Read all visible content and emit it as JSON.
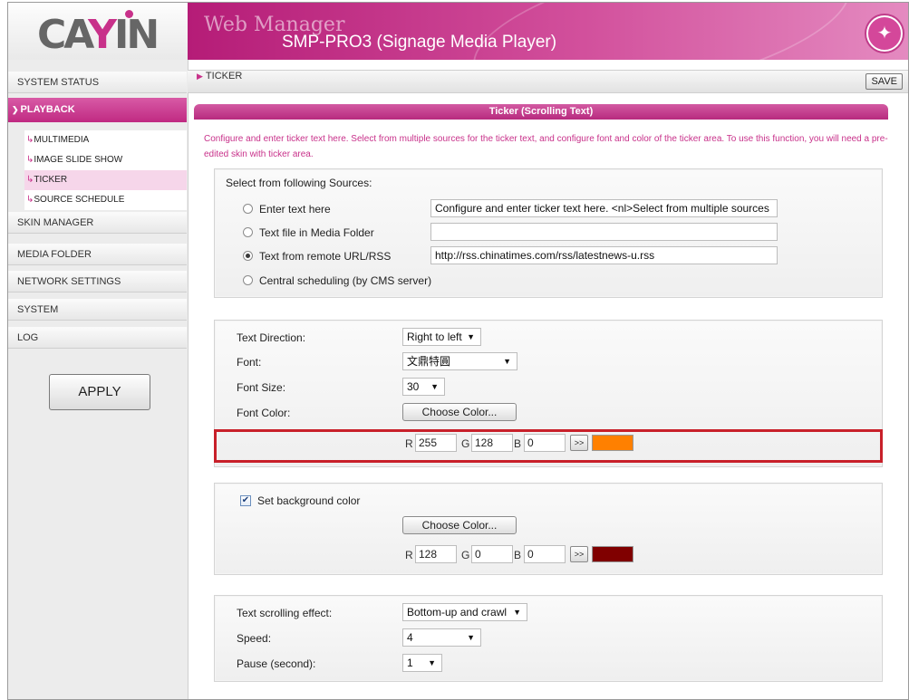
{
  "header": {
    "logo_text": "CAYIN",
    "web_manager": "Web Manager",
    "model": "SMP-PRO3 (Signage Media Player)"
  },
  "sidebar": {
    "items": [
      {
        "label": "SYSTEM STATUS"
      },
      {
        "label": "PLAYBACK"
      },
      {
        "label": "SKIN MANAGER"
      },
      {
        "label": "MEDIA FOLDER"
      },
      {
        "label": "NETWORK SETTINGS"
      },
      {
        "label": "SYSTEM"
      },
      {
        "label": "LOG"
      }
    ],
    "playback_sub": [
      {
        "label": "MULTIMEDIA"
      },
      {
        "label": "IMAGE SLIDE SHOW"
      },
      {
        "label": "TICKER"
      },
      {
        "label": "SOURCE SCHEDULE"
      }
    ],
    "apply_label": "APPLY"
  },
  "toolbar": {
    "breadcrumb": "TICKER",
    "save_label": "SAVE"
  },
  "main": {
    "title": "Ticker (Scrolling Text)",
    "description": "Configure and enter ticker text here. Select from multiple sources for the ticker text, and configure font and color of the ticker area. To use this function, you will need a pre-edited skin with ticker area.",
    "sources": {
      "heading": "Select from following Sources:",
      "options": [
        {
          "label": "Enter text here",
          "value": "Configure and enter ticker text here. <nl>Select from multiple sources",
          "selected": false
        },
        {
          "label": "Text file in Media Folder",
          "value": "",
          "selected": false
        },
        {
          "label": "Text from remote URL/RSS",
          "value": "http://rss.chinatimes.com/rss/latestnews-u.rss",
          "selected": true
        },
        {
          "label": "Central scheduling (by CMS server)",
          "selected": false
        }
      ]
    },
    "font": {
      "direction_label": "Text Direction:",
      "direction_value": "Right to left",
      "font_label": "Font:",
      "font_value": "文鼎特圓",
      "size_label": "Font Size:",
      "size_value": "30",
      "color_label": "Font Color:",
      "choose_color": "Choose Color...",
      "r_label": "R",
      "r": "255",
      "g_label": "G",
      "g": "128",
      "b_label": "B",
      "b": "0",
      "arrow": ">>",
      "swatch_color": "#ff8000"
    },
    "background": {
      "checkbox_label": "Set background color",
      "checked": true,
      "choose_color": "Choose Color...",
      "r_label": "R",
      "r": "128",
      "g_label": "G",
      "g": "0",
      "b_label": "B",
      "b": "0",
      "arrow": ">>",
      "swatch_color": "#800000"
    },
    "effect": {
      "effect_label": "Text scrolling effect:",
      "effect_value": "Bottom-up and crawl",
      "speed_label": "Speed:",
      "speed_value": "4",
      "pause_label": "Pause (second):",
      "pause_value": "1"
    }
  },
  "colors": {
    "accent": "#c8318a",
    "highlight": "#c8202a"
  }
}
